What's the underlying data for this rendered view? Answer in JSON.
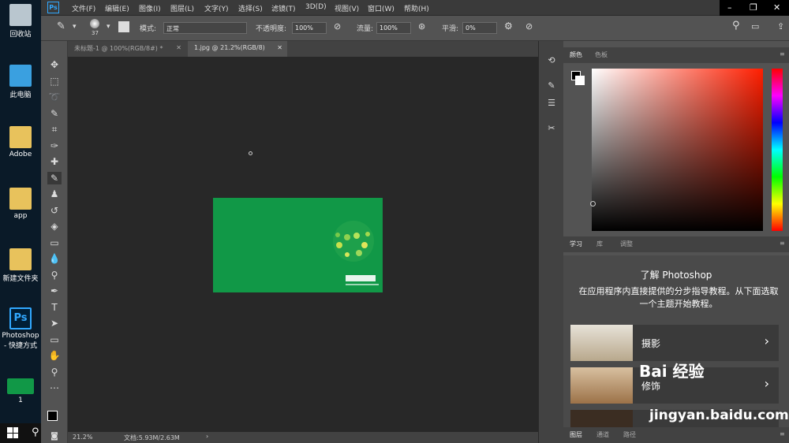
{
  "desktop": {
    "icons": [
      {
        "label": "回收站",
        "name": "recycle-bin"
      },
      {
        "label": "此电脑",
        "name": "this-pc"
      },
      {
        "label": "Adobe",
        "name": "adobe-folder"
      },
      {
        "label": "app",
        "name": "app-folder"
      },
      {
        "label": "新建文件夹",
        "name": "new-folder"
      },
      {
        "label": "Photoshop - 快捷方式",
        "name": "photoshop-shortcut"
      },
      {
        "label": "1",
        "name": "image-file"
      }
    ]
  },
  "menu": {
    "logo": "Ps",
    "items": [
      "文件(F)",
      "编辑(E)",
      "图像(I)",
      "图层(L)",
      "文字(Y)",
      "选择(S)",
      "滤镜(T)",
      "3D(D)",
      "视图(V)",
      "窗口(W)",
      "帮助(H)"
    ]
  },
  "options": {
    "brush_size": "37",
    "mode_label": "模式:",
    "mode_value": "正常",
    "opacity_label": "不透明度:",
    "opacity_value": "100%",
    "flow_label": "流量:",
    "flow_value": "100%",
    "smooth_label": "平滑:",
    "smooth_value": "0%"
  },
  "tabs": [
    {
      "label": "未标题-1 @ 100%(RGB/8#) *",
      "active": false
    },
    {
      "label": "1.jpg @ 21.2%(RGB/8)",
      "active": true
    }
  ],
  "status": {
    "zoom": "21.2%",
    "doc": "文档:5.93M/2.63M"
  },
  "panels": {
    "color_tabs": [
      "颜色",
      "色板"
    ],
    "learn_tabs": [
      "学习",
      "库",
      "调整"
    ],
    "learn_title": "了解 Photoshop",
    "learn_desc": "在应用程序内直接提供的分步指导教程。从下面选取一个主题开始教程。",
    "cards": [
      "摄影",
      "修饰"
    ],
    "bottom_tabs": [
      "图层",
      "通道",
      "路径"
    ]
  },
  "watermark": {
    "text": "Bai 经验",
    "url": "jingyan.baidu.com"
  },
  "colors": {
    "accent": "#31a8ff",
    "image_green": "#119847"
  }
}
